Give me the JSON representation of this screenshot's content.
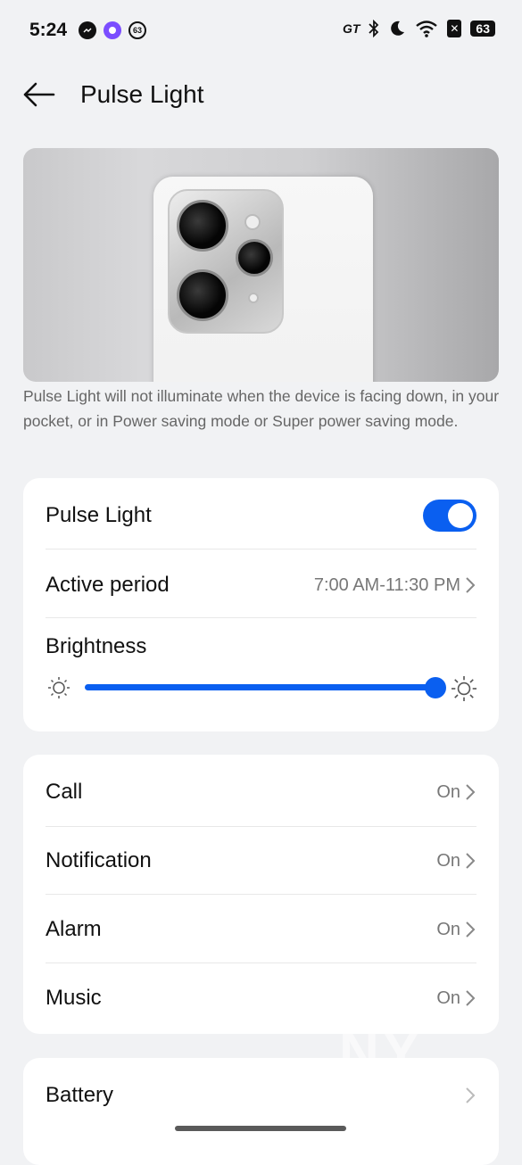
{
  "status_bar": {
    "time": "5:24",
    "badge": "63",
    "carrier": "GT",
    "battery": "63",
    "icons": [
      "messenger-icon",
      "assistant-icon",
      "notification-badge-icon",
      "gt-icon",
      "bluetooth-icon",
      "moon-icon",
      "wifi-icon",
      "sim-off-icon",
      "battery-icon"
    ]
  },
  "header": {
    "title": "Pulse Light"
  },
  "hero": {
    "note": "Pulse Light will not illuminate when the device is facing down, in your pocket, or in Power saving mode or Super power saving mode."
  },
  "settings": {
    "pulse_light": {
      "label": "Pulse Light",
      "enabled": true
    },
    "active_period": {
      "label": "Active period",
      "value": "7:00 AM-11:30 PM"
    },
    "brightness": {
      "label": "Brightness",
      "level": 1.0
    }
  },
  "events": [
    {
      "label": "Call",
      "value": "On"
    },
    {
      "label": "Notification",
      "value": "On"
    },
    {
      "label": "Alarm",
      "value": "On"
    },
    {
      "label": "Music",
      "value": "On"
    }
  ],
  "battery_row": {
    "label": "Battery"
  },
  "watermark": "NY\nGKS",
  "colors": {
    "accent": "#0a5ff0",
    "background": "#f1f2f4",
    "card": "#ffffff"
  }
}
